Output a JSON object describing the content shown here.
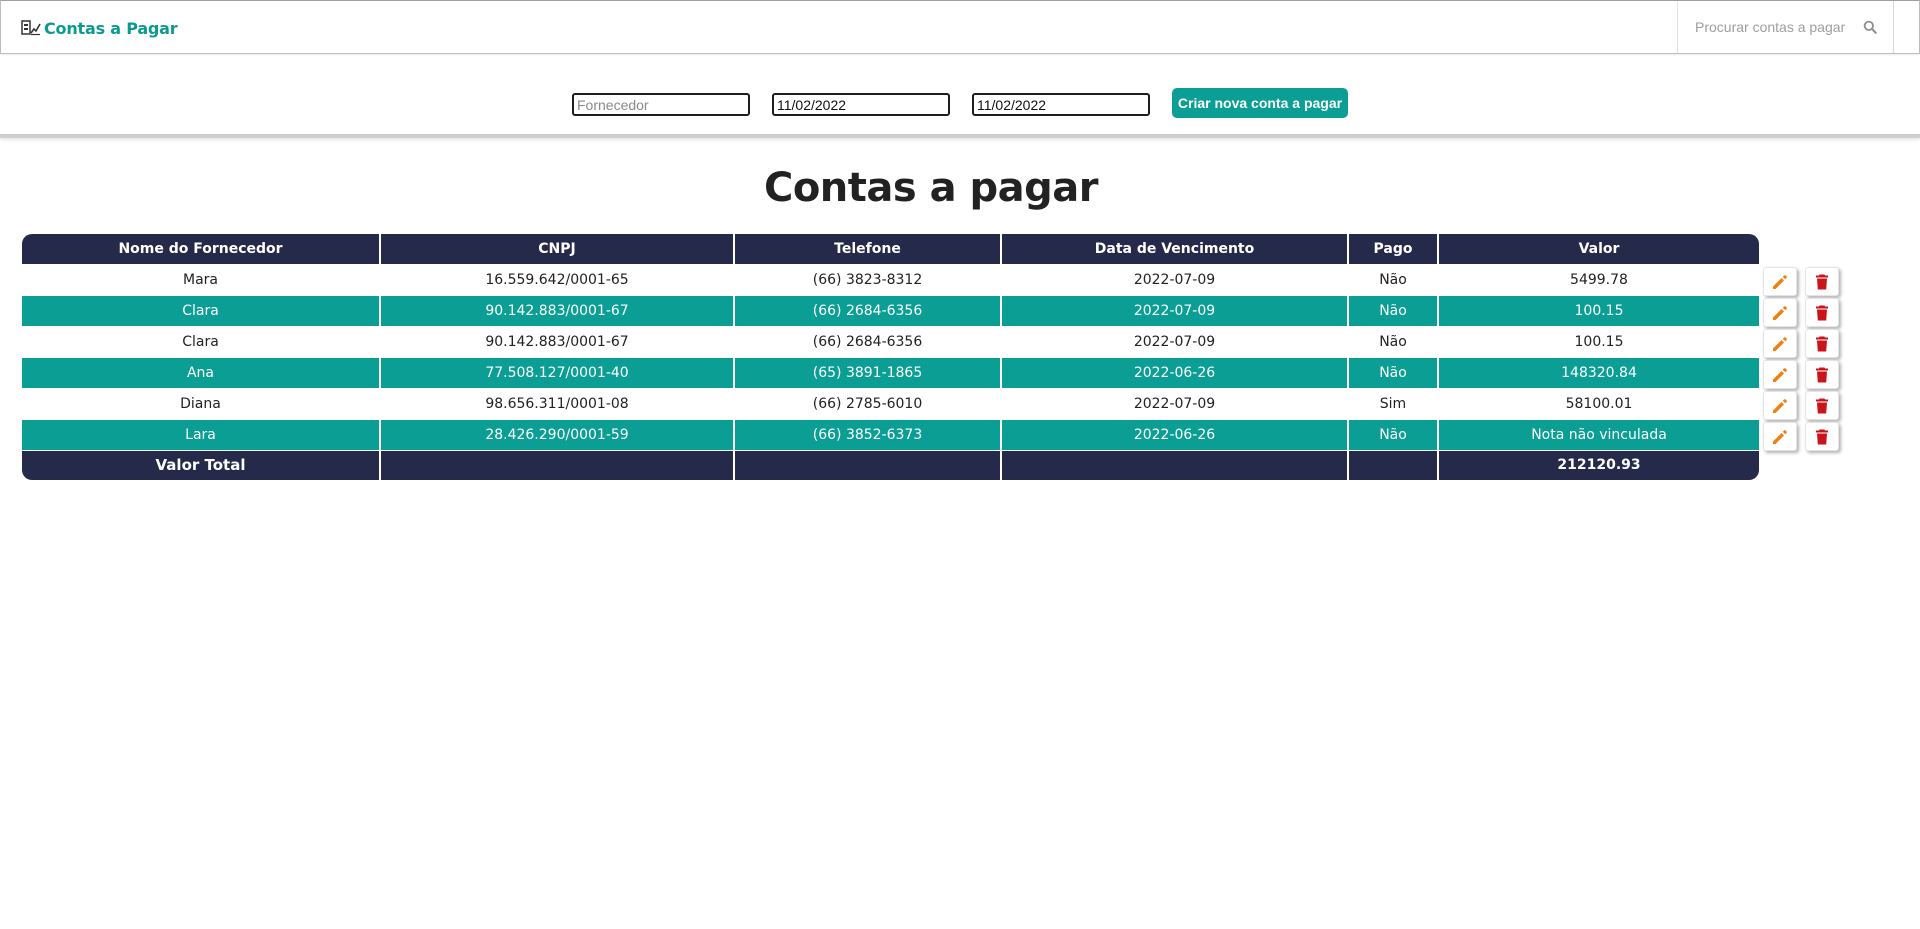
{
  "navbar": {
    "brand_text": "Contas a Pagar",
    "search_placeholder": "Procurar contas a pagar"
  },
  "filters": {
    "supplier_placeholder": "Fornecedor",
    "date_from": "11/02/2022",
    "date_to": "11/02/2022",
    "create_button_label": "Criar nova conta a pagar"
  },
  "page_title": "Contas a pagar",
  "table": {
    "headers": [
      "Nome do Fornecedor",
      "CNPJ",
      "Telefone",
      "Data de Vencimento",
      "Pago",
      "Valor"
    ],
    "rows": [
      [
        "Mara",
        "16.559.642/0001-65",
        "(66) 3823-8312",
        "2022-07-09",
        "Não",
        "5499.78"
      ],
      [
        "Clara",
        "90.142.883/0001-67",
        "(66) 2684-6356",
        "2022-07-09",
        "Não",
        "100.15"
      ],
      [
        "Clara",
        "90.142.883/0001-67",
        "(66) 2684-6356",
        "2022-07-09",
        "Não",
        "100.15"
      ],
      [
        "Ana",
        "77.508.127/0001-40",
        "(65) 3891-1865",
        "2022-06-26",
        "Não",
        "148320.84"
      ],
      [
        "Diana",
        "98.656.311/0001-08",
        "(66) 2785-6010",
        "2022-07-09",
        "Sim",
        "58100.01"
      ],
      [
        "Lara",
        "28.426.290/0001-59",
        "(66) 3852-6373",
        "2022-06-26",
        "Não",
        "Nota não vinculada"
      ]
    ],
    "footer": [
      "Valor Total",
      "",
      "",
      "",
      "",
      "212120.93"
    ]
  },
  "colors": {
    "brand": "#0b9a8f",
    "accent": "#0b9e94",
    "header_bg": "#252a4b",
    "edit_icon": "#f07f10",
    "delete_icon": "#c8141a"
  },
  "icons": {
    "brand": "chart-icon",
    "search": "search-icon",
    "edit": "pencil-icon",
    "delete": "trash-icon"
  }
}
